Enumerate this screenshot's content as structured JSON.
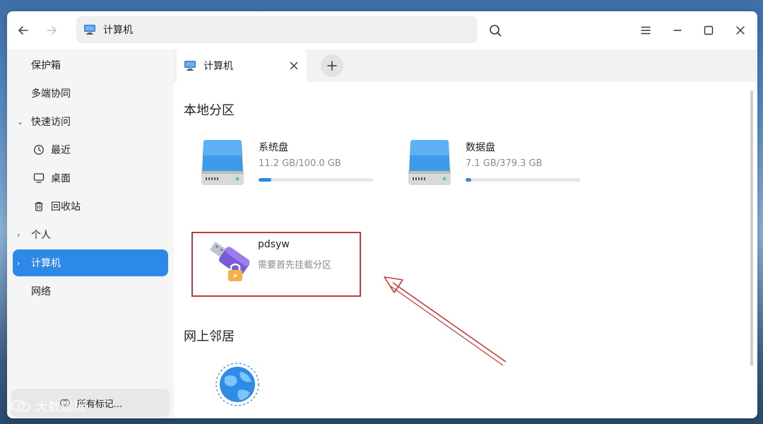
{
  "titlebar": {
    "back_icon": "arrow-left-icon",
    "forward_icon": "arrow-right-icon",
    "address": "计算机",
    "search_icon": "search-icon",
    "menu_icon": "hamburger-icon",
    "minimize_icon": "minimize-icon",
    "maximize_icon": "maximize-icon",
    "close_icon": "close-icon"
  },
  "sidebar": {
    "items": [
      {
        "label": "保护箱"
      },
      {
        "label": "多端协同"
      },
      {
        "label": "快速访问",
        "expanded": true
      },
      {
        "label": "最近",
        "icon": "clock-icon"
      },
      {
        "label": "桌面",
        "icon": "monitor-icon"
      },
      {
        "label": "回收站",
        "icon": "trash-icon"
      },
      {
        "label": "个人",
        "expanded": false
      },
      {
        "label": "计算机",
        "active": true
      },
      {
        "label": "网络"
      }
    ],
    "tags_button": "所有标记..."
  },
  "tabs": [
    {
      "label": "计算机",
      "active": true
    }
  ],
  "main": {
    "local_section_title": "本地分区",
    "disks": [
      {
        "name": "系统盘",
        "size": "11.2 GB/100.0 GB",
        "usage": 0.112
      },
      {
        "name": "数据盘",
        "size": "7.1 GB/379.3 GB",
        "usage": 0.019
      }
    ],
    "usb": {
      "name": "pdsyw",
      "status": "需要首先挂载分区",
      "icon": "usb-drive-locked-icon"
    },
    "network_section_title": "网上邻居",
    "network_icon": "globe-icon"
  },
  "watermark": "大数瑶瑶",
  "colors": {
    "accent": "#2d89e6",
    "annotation": "#c23a3a"
  }
}
